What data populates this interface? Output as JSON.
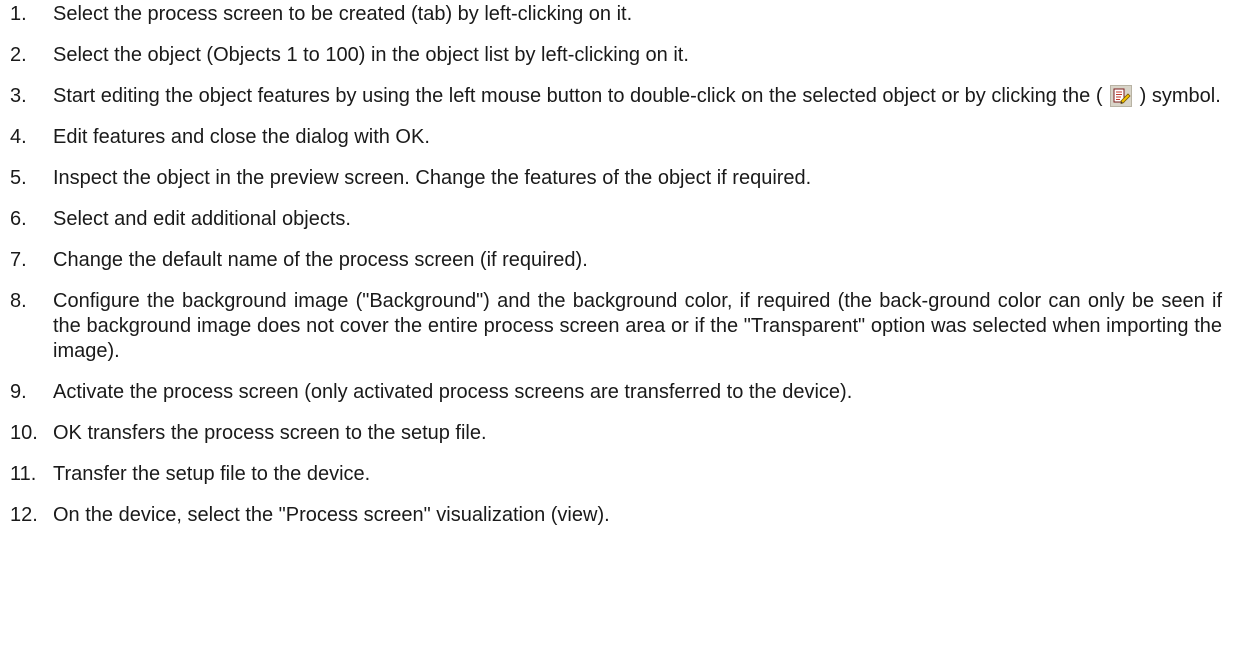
{
  "steps": [
    {
      "num": "1.",
      "text": "Select the process screen to be created (tab) by left-clicking on it."
    },
    {
      "num": "2.",
      "text": "Select the object (Objects 1 to 100) in the object list by left-clicking on it."
    },
    {
      "num": "3.",
      "text_before": "Start editing the object features by using the left mouse button to double-click on the selected object or by clicking the (",
      "icon": "edit-document-icon",
      "text_after": ") symbol."
    },
    {
      "num": "4.",
      "text": "Edit features and close the dialog with OK."
    },
    {
      "num": "5.",
      "text": "Inspect the object in the preview screen. Change the features of the object if required."
    },
    {
      "num": "6.",
      "text": "Select and edit additional objects."
    },
    {
      "num": "7.",
      "text": "Change the default name of the process screen (if required)."
    },
    {
      "num": "8.",
      "text": "Configure the background image (\"Background\") and the background color, if required (the back-ground color can only be seen if the background image does not cover the entire process screen area or if the \"Transparent\" option was selected when importing the image)."
    },
    {
      "num": "9.",
      "text": "Activate the process screen (only activated process screens are transferred to the device)."
    },
    {
      "num": "10.",
      "text": "OK transfers the process screen to the setup file."
    },
    {
      "num": "11.",
      "text": "Transfer the setup file to the device."
    },
    {
      "num": "12.",
      "text": "On the device, select the \"Process screen\" visualization (view)."
    }
  ]
}
